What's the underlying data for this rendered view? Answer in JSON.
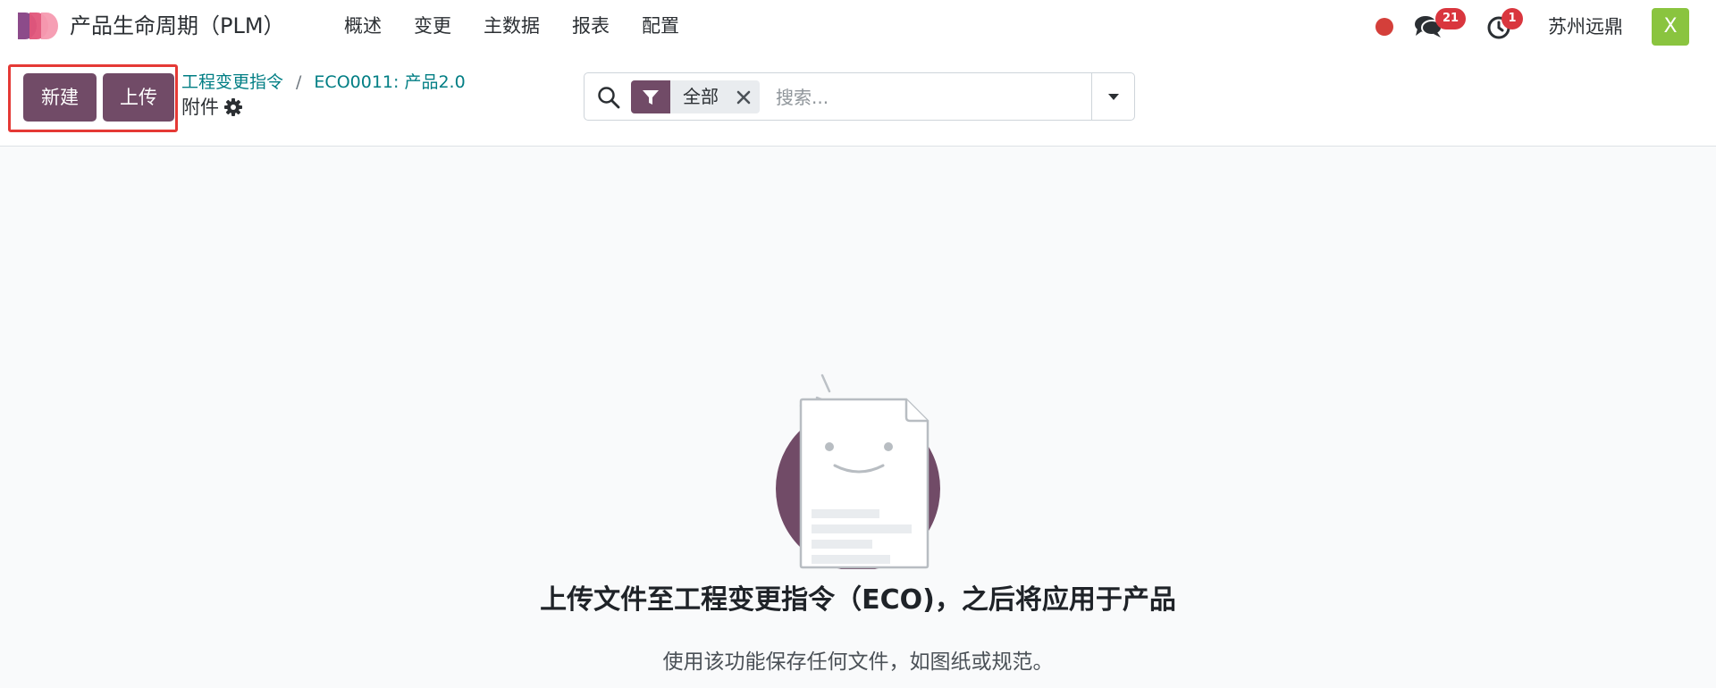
{
  "navbar": {
    "app_title": "产品生命周期（PLM）",
    "menu": [
      "概述",
      "变更",
      "主数据",
      "报表",
      "配置"
    ],
    "chat_badge": "21",
    "activity_badge": "1",
    "company": "苏州远鼎",
    "avatar_initial": "X",
    "status_color": "#d43f3a"
  },
  "control_panel": {
    "new_button": "新建",
    "upload_button": "上传",
    "breadcrumb": [
      "工程变更指令",
      "ECO0011: 产品2.0"
    ],
    "breadcrumb_separator": "/",
    "page_title": "附件",
    "search": {
      "facet_label": "全部",
      "placeholder": "搜索..."
    }
  },
  "empty_state": {
    "title": "上传文件至工程变更指令（ECO)，之后将应用于产品",
    "description": "使用该功能保存任何文件，如图纸或规范。"
  },
  "colors": {
    "primary": "#714b67",
    "link": "#017e84",
    "highlight": "#e53935",
    "avatar": "#8ac43f"
  },
  "icons": [
    "logo-icon",
    "chat-icon",
    "clock-icon",
    "gear-icon",
    "search-icon",
    "filter-icon",
    "close-icon",
    "caret-down-icon",
    "empty-document-icon"
  ]
}
